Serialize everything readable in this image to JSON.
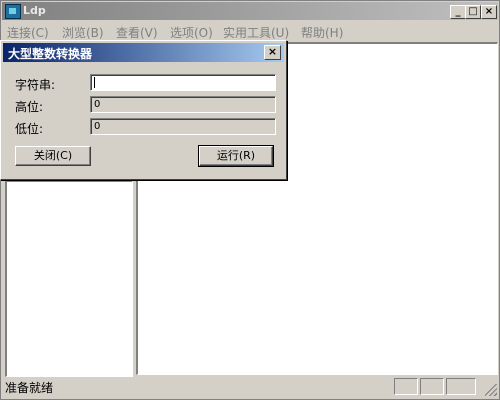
{
  "window": {
    "title": "Ldp",
    "min_glyph": "_",
    "max_glyph": "□",
    "close_glyph": "×"
  },
  "menu": [
    {
      "label": "连接(C)"
    },
    {
      "label": "浏览(B)"
    },
    {
      "label": "查看(V)"
    },
    {
      "label": "选项(O)"
    },
    {
      "label": "实用工具(U)"
    },
    {
      "label": "帮助(H)"
    }
  ],
  "dialog": {
    "title": "大型整数转换器",
    "close_glyph": "×",
    "string_label": "字符串:",
    "string_value": "",
    "high_label": "高位:",
    "high_value": "0",
    "low_label": "低位:",
    "low_value": "0",
    "close_button": "关闭(C)",
    "run_button": "运行(R)"
  },
  "status": {
    "text": "准备就绪"
  },
  "colors": {
    "dialog_title": "#0a246a",
    "face": "#d4d0c8"
  }
}
